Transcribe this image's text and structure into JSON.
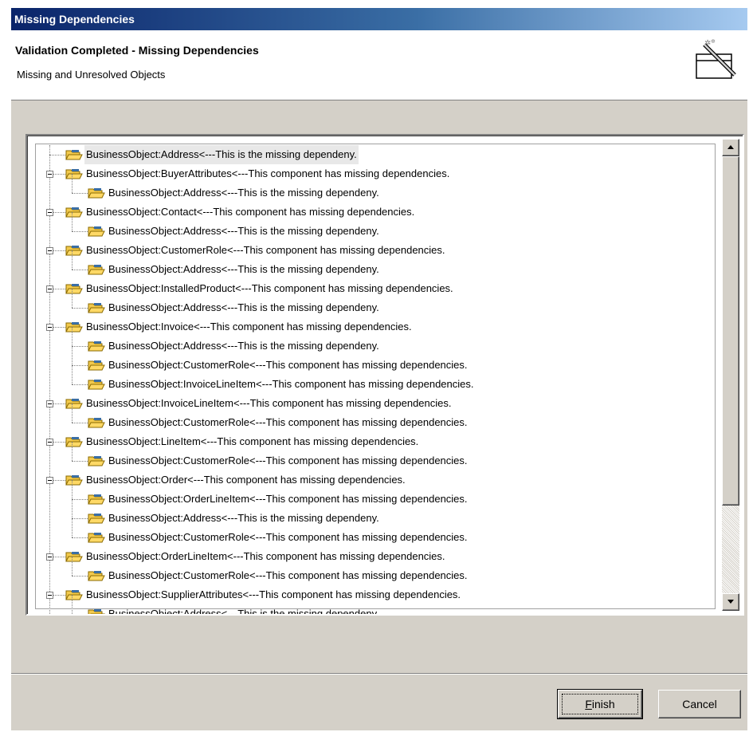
{
  "window": {
    "title": "Missing Dependencies"
  },
  "header": {
    "title": "Validation Completed - Missing Dependencies",
    "subtitle": "Missing and Unresolved Objects",
    "icon": "wizard-wand-icon"
  },
  "tree": {
    "items": [
      {
        "label": "BusinessObject:Address<---This is the missing dependeny.",
        "level": 0,
        "expandable": false,
        "selected": true
      },
      {
        "label": "BusinessObject:BuyerAttributes<---This component has missing dependencies.",
        "level": 0,
        "expandable": true
      },
      {
        "label": "BusinessObject:Address<---This is the missing dependeny.",
        "level": 1
      },
      {
        "label": "BusinessObject:Contact<---This component has missing dependencies.",
        "level": 0,
        "expandable": true
      },
      {
        "label": "BusinessObject:Address<---This is the missing dependeny.",
        "level": 1
      },
      {
        "label": "BusinessObject:CustomerRole<---This component has missing dependencies.",
        "level": 0,
        "expandable": true
      },
      {
        "label": "BusinessObject:Address<---This is the missing dependeny.",
        "level": 1
      },
      {
        "label": "BusinessObject:InstalledProduct<---This component has missing dependencies.",
        "level": 0,
        "expandable": true
      },
      {
        "label": "BusinessObject:Address<---This is the missing dependeny.",
        "level": 1
      },
      {
        "label": "BusinessObject:Invoice<---This component has missing dependencies.",
        "level": 0,
        "expandable": true
      },
      {
        "label": "BusinessObject:Address<---This is the missing dependeny.",
        "level": 1
      },
      {
        "label": "BusinessObject:CustomerRole<---This component has missing dependencies.",
        "level": 1
      },
      {
        "label": "BusinessObject:InvoiceLineItem<---This component has missing dependencies.",
        "level": 1
      },
      {
        "label": "BusinessObject:InvoiceLineItem<---This component has missing dependencies.",
        "level": 0,
        "expandable": true
      },
      {
        "label": "BusinessObject:CustomerRole<---This component has missing dependencies.",
        "level": 1
      },
      {
        "label": "BusinessObject:LineItem<---This component has missing dependencies.",
        "level": 0,
        "expandable": true
      },
      {
        "label": "BusinessObject:CustomerRole<---This component has missing dependencies.",
        "level": 1
      },
      {
        "label": "BusinessObject:Order<---This component has missing dependencies.",
        "level": 0,
        "expandable": true
      },
      {
        "label": "BusinessObject:OrderLineItem<---This component has missing dependencies.",
        "level": 1
      },
      {
        "label": "BusinessObject:Address<---This is the missing dependeny.",
        "level": 1
      },
      {
        "label": "BusinessObject:CustomerRole<---This component has missing dependencies.",
        "level": 1
      },
      {
        "label": "BusinessObject:OrderLineItem<---This component has missing dependencies.",
        "level": 0,
        "expandable": true
      },
      {
        "label": "BusinessObject:CustomerRole<---This component has missing dependencies.",
        "level": 1
      },
      {
        "label": "BusinessObject:SupplierAttributes<---This component has missing dependencies.",
        "level": 0,
        "expandable": true
      },
      {
        "label": "BusinessObject:Address<---This is the missing dependeny.",
        "level": 1
      }
    ],
    "scroll_position": 0.0,
    "scroll_visible_fraction": 0.8
  },
  "buttons": {
    "finish": {
      "mnemonic": "F",
      "rest": "inish"
    },
    "cancel": "Cancel"
  },
  "colors": {
    "titlebar_start": "#0a246a",
    "titlebar_end": "#a6caf0",
    "folder": "#f2c94c",
    "folder_blue": "#3a6ea5",
    "dialog_bg": "#d4d0c8"
  }
}
